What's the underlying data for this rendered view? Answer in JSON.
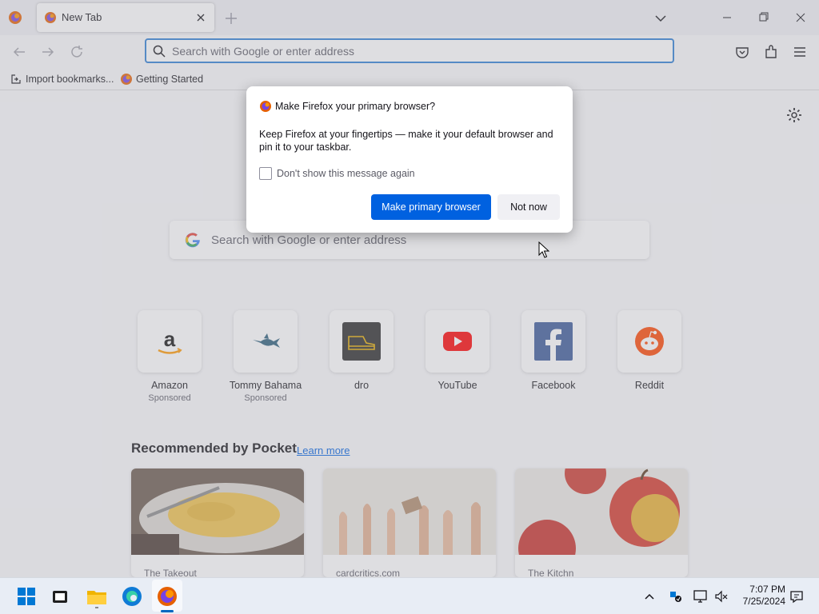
{
  "tab": {
    "title": "New Tab"
  },
  "urlbar": {
    "placeholder": "Search with Google or enter address"
  },
  "bookmarks": [
    {
      "label": "Import bookmarks..."
    },
    {
      "label": "Getting Started"
    }
  ],
  "search": {
    "placeholder": "Search with Google or enter address"
  },
  "top_sites": [
    {
      "label": "Amazon",
      "sponsored": "Sponsored"
    },
    {
      "label": "Tommy Bahama",
      "sponsored": "Sponsored"
    },
    {
      "label": "dro",
      "sponsored": ""
    },
    {
      "label": "YouTube",
      "sponsored": ""
    },
    {
      "label": "Facebook",
      "sponsored": ""
    },
    {
      "label": "Reddit",
      "sponsored": ""
    }
  ],
  "pocket": {
    "title": "Recommended by Pocket",
    "learn_more": "Learn more",
    "cards": [
      {
        "source": "The Takeout"
      },
      {
        "source": "cardcritics.com"
      },
      {
        "source": "The Kitchn"
      }
    ]
  },
  "dialog": {
    "title": "Make Firefox your primary browser?",
    "body": "Keep Firefox at your fingertips — make it your default browser and pin it to your taskbar.",
    "checkbox_label": "Don't show this message again",
    "primary_button": "Make primary browser",
    "secondary_button": "Not now"
  },
  "taskbar": {
    "time": "7:07 PM",
    "date": "7/25/2024"
  },
  "colors": {
    "accent": "#0061e0",
    "urlbar_focus": "#2d7ed4"
  }
}
